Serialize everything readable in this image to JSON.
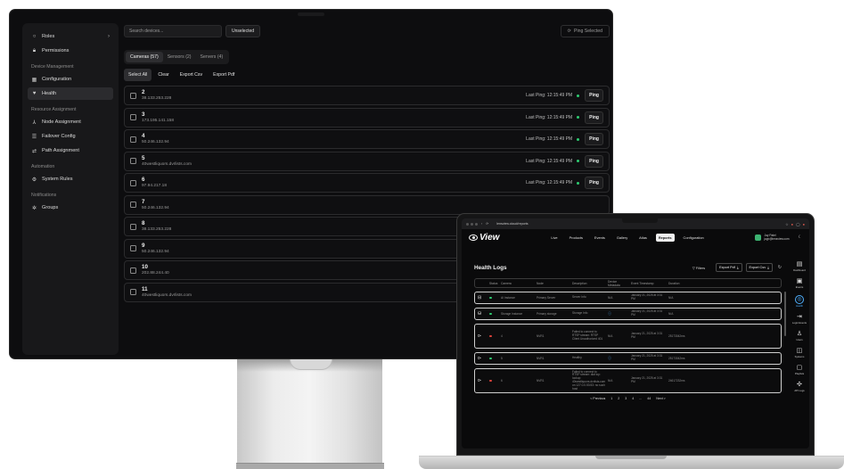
{
  "colors": {
    "accent_green": "#2ecc71",
    "accent_blue": "#4fb0ff",
    "error_red": "#e0433b",
    "ok_green": "#2ecc71"
  },
  "monitor": {
    "sidebar": {
      "top_items": [
        {
          "label": "Roles",
          "icon": "circle-icon",
          "has_chevron": true
        },
        {
          "label": "Permissions",
          "icon": "lock-icon"
        }
      ],
      "sections": [
        {
          "heading": "Device Management",
          "items": [
            {
              "label": "Configuration",
              "icon": "grid-icon",
              "active": false
            },
            {
              "label": "Health",
              "icon": "heartbeat-icon",
              "active": true
            }
          ]
        },
        {
          "heading": "Resource Assignment",
          "items": [
            {
              "label": "Node Assignment",
              "icon": "nodes-icon"
            },
            {
              "label": "Failover Config",
              "icon": "server-icon"
            },
            {
              "label": "Path Assignment",
              "icon": "path-icon"
            }
          ]
        },
        {
          "heading": "Automation",
          "items": [
            {
              "label": "System Rules",
              "icon": "gear-icon"
            }
          ]
        },
        {
          "heading": "Notifications",
          "items": [
            {
              "label": "Groups",
              "icon": "group-icon"
            }
          ]
        }
      ]
    },
    "toolbar": {
      "search_placeholder": "Search devices...",
      "filter_label": "Unselected",
      "ping_selected": "Ping Selected"
    },
    "tabs": [
      {
        "label": "Cameras (57)",
        "active": true
      },
      {
        "label": "Sensors (2)",
        "active": false
      },
      {
        "label": "Servers (4)",
        "active": false
      }
    ],
    "actions": [
      {
        "label": "Select All",
        "primary": true
      },
      {
        "label": "Clear"
      },
      {
        "label": "Export Csv"
      },
      {
        "label": "Export Pdf"
      }
    ],
    "devices": [
      {
        "id": "2",
        "ip": "38.133.253.228",
        "last_ping": "Last Ping: 12:15:49 PM",
        "ping": "Ping"
      },
      {
        "id": "3",
        "ip": "173.195.141.158",
        "last_ping": "Last Ping: 12:15:49 PM",
        "ping": "Ping"
      },
      {
        "id": "4",
        "ip": "50.246.132.94",
        "last_ping": "Last Ping: 12:15:49 PM",
        "ping": "Ping"
      },
      {
        "id": "5",
        "ip": "40westliquors.dvrlists.com",
        "last_ping": "Last Ping: 12:15:49 PM",
        "ping": "Ping"
      },
      {
        "id": "6",
        "ip": "97.94.217.18",
        "last_ping": "Last Ping: 12:15:49 PM",
        "ping": "Ping"
      },
      {
        "id": "7",
        "ip": "50.246.132.94",
        "last_ping": "",
        "ping": ""
      },
      {
        "id": "8",
        "ip": "38.133.253.228",
        "last_ping": "",
        "ping": ""
      },
      {
        "id": "9",
        "ip": "50.246.132.94",
        "last_ping": "",
        "ping": ""
      },
      {
        "id": "10",
        "ip": "202.88.244.40",
        "last_ping": "",
        "ping": ""
      },
      {
        "id": "11",
        "ip": "40westliquors.dvrlists.com",
        "last_ping": "",
        "ping": ""
      }
    ]
  },
  "laptop": {
    "browser": {
      "url": "lensview.cloud/reports"
    },
    "logo": "View",
    "menu": [
      {
        "label": "Live"
      },
      {
        "label": "Products"
      },
      {
        "label": "Events"
      },
      {
        "label": "Gallery"
      },
      {
        "label": "Atlas"
      },
      {
        "label": "Reports",
        "active": true
      },
      {
        "label": "Configuration"
      }
    ],
    "user": {
      "name": "Jay Patel",
      "email": "jayp@lensview.com"
    },
    "health_logs": {
      "title": "Health Logs",
      "filters": "Filters",
      "export_pdf": "Export Pdf",
      "export_csv": "Export Csv",
      "columns": [
        "Status",
        "Camera",
        "Node",
        "Description",
        "Device Metadata",
        "Event Timestamp",
        "Duration"
      ],
      "rows": [
        {
          "icon": "server-icon",
          "status": "ok",
          "camera": "AI Instance",
          "node": "Primary Server",
          "description": "Server Info",
          "metadata": "N/A",
          "timestamp": "January 21, 2025 at 3:31 PM",
          "duration": "N/A"
        },
        {
          "icon": "storage-icon",
          "status": "ok",
          "camera": "Storage Instance",
          "node": "Primary storage",
          "description": "Storage Info",
          "metadata": "info-icon",
          "timestamp": "January 21, 2025 at 3:31 PM",
          "duration": "N/A"
        },
        {
          "icon": "camera-icon",
          "status": "error",
          "camera": "4",
          "node": "NVR1",
          "description": "Failed to connect to RTSP stream: RTSP Client Unauthorized 401",
          "metadata": "N/A",
          "timestamp": "January 21, 2025 at 3:31 PM",
          "duration": "25173042ms"
        },
        {
          "icon": "camera-icon",
          "status": "ok",
          "camera": "5",
          "node": "NVR1",
          "description": "Healthy",
          "metadata": "info-icon",
          "timestamp": "January 21, 2025 at 3:31 PM",
          "duration": "25173042ms"
        },
        {
          "icon": "camera-icon",
          "status": "error",
          "camera": "6",
          "node": "NVR1",
          "description": "Failed to connect to RTSP stream: dial tcp: lookup 40westliquors.dvrlists.com on 127.0.0.53:53: no such host",
          "metadata": "N/A",
          "timestamp": "January 21, 2025 at 3:31 PM",
          "duration": "24617232ms"
        }
      ],
      "pager": {
        "prev": "< Previous",
        "pages": [
          "1",
          "2",
          "3",
          "4",
          "...",
          "44"
        ],
        "next": "Next >"
      }
    },
    "right_rail": [
      {
        "label": "Dashboard",
        "icon": "dashboard-icon"
      },
      {
        "label": "Events",
        "icon": "events-icon"
      },
      {
        "label": "Health",
        "icon": "health-icon",
        "active": true
      },
      {
        "label": "Login Events",
        "icon": "login-icon"
      },
      {
        "label": "Users",
        "icon": "user-icon"
      },
      {
        "label": "Systems",
        "icon": "system-icon"
      },
      {
        "label": "Playlists",
        "icon": "playlist-icon"
      },
      {
        "label": "API Logs",
        "icon": "api-icon"
      }
    ]
  }
}
